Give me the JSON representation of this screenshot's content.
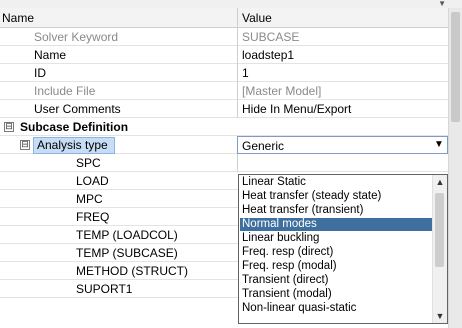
{
  "header": {
    "col_name": "Name",
    "col_value": "Value"
  },
  "properties": [
    {
      "name": "Solver Keyword",
      "value": "SUBCASE"
    },
    {
      "name": "Name",
      "value": "loadstep1"
    },
    {
      "name": "ID",
      "value": "1"
    },
    {
      "name": "Include File",
      "value": "[Master Model]"
    },
    {
      "name": "User Comments",
      "value": "Hide In Menu/Export"
    }
  ],
  "section": {
    "toggle": "⊟",
    "label": "Subcase Definition"
  },
  "analysis_type": {
    "toggle": "⊟",
    "label": "Analysis type",
    "value": "Generic",
    "dropdown_icon": "chevron-down-icon"
  },
  "sub_items": [
    "SPC",
    "LOAD",
    "MPC",
    "FREQ",
    "TEMP (LOADCOL)",
    "TEMP (SUBCASE)",
    "METHOD (STRUCT)",
    "SUPORT1"
  ],
  "dropdown": {
    "options": [
      "Linear Static",
      "Heat transfer (steady state)",
      "Heat transfer (transient)",
      "Normal modes",
      "Linear buckling",
      "Freq. resp (direct)",
      "Freq. resp (modal)",
      "Transient (direct)",
      "Transient (modal)",
      "Non-linear quasi-static"
    ],
    "selected_index": 3
  },
  "colors": {
    "selection": "#3e6f9e",
    "label_highlight": "#c7dcf5"
  }
}
